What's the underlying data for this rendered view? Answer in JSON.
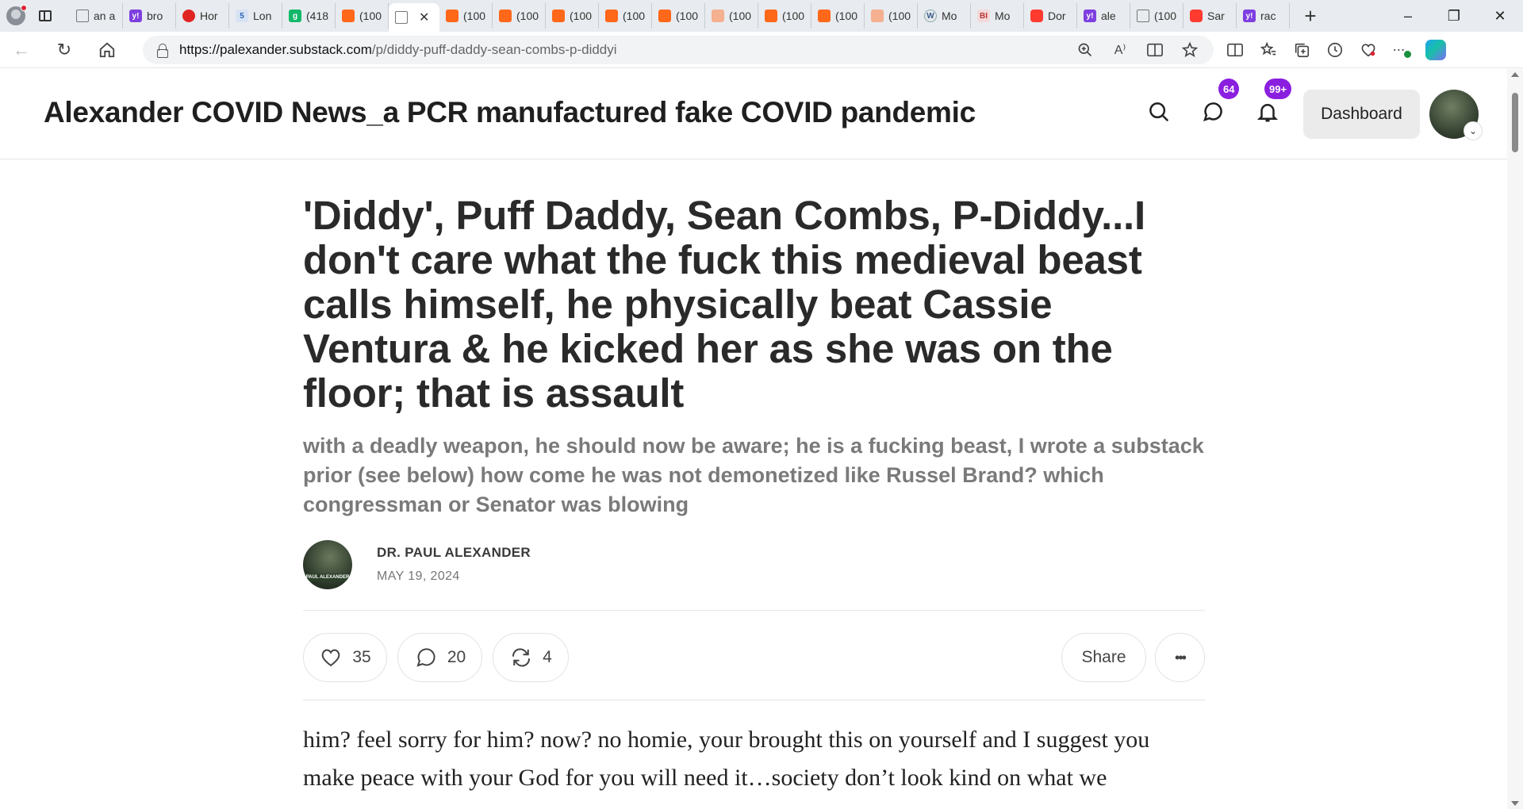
{
  "browser": {
    "tabs": [
      {
        "label": "an a",
        "icon": "document-icon"
      },
      {
        "label": "bro",
        "icon": "yahoo-icon"
      },
      {
        "label": "Hor",
        "icon": "red-pin-icon"
      },
      {
        "label": "Lon",
        "icon": "five-icon"
      },
      {
        "label": "(418",
        "icon": "g-icon"
      },
      {
        "label": "(100",
        "icon": "substack-icon"
      },
      {
        "label": "",
        "icon": "document-icon",
        "active": true
      },
      {
        "label": "(100",
        "icon": "substack-icon"
      },
      {
        "label": "(100",
        "icon": "substack-icon"
      },
      {
        "label": "(100",
        "icon": "substack-icon"
      },
      {
        "label": "(100",
        "icon": "substack-icon"
      },
      {
        "label": "(100",
        "icon": "substack-icon"
      },
      {
        "label": "(100",
        "icon": "substack-light-icon"
      },
      {
        "label": "(100",
        "icon": "substack-icon"
      },
      {
        "label": "(100",
        "icon": "substack-icon"
      },
      {
        "label": "(100",
        "icon": "substack-light-icon"
      },
      {
        "label": "Mo",
        "icon": "wordpress-icon"
      },
      {
        "label": "Mo",
        "icon": "bi-icon"
      },
      {
        "label": "Dor",
        "icon": "youtube-icon"
      },
      {
        "label": "ale",
        "icon": "yahoo-icon"
      },
      {
        "label": "(100",
        "icon": "document-icon"
      },
      {
        "label": "Sar",
        "icon": "youtube-icon"
      },
      {
        "label": "rac",
        "icon": "yahoo-icon"
      }
    ],
    "url_host": "https://palexander.substack.com",
    "url_path": "/p/diddy-puff-daddy-sean-combs-p-diddyi"
  },
  "site": {
    "title": "Alexander COVID News_a PCR manufactured fake COVID pandemic",
    "chat_badge": "64",
    "notif_badge": "99+",
    "dashboard_label": "Dashboard"
  },
  "post": {
    "title": "'Diddy', Puff Daddy, Sean Combs, P-Diddy...I don't care what the fuck this medieval beast calls himself, he physically beat Cassie Ventura & he kicked her as she was on the floor; that is assault",
    "subtitle": "with a deadly weapon, he should now be aware; he is a fucking beast, I wrote a substack prior (see below) how come he was not demonetized like Russel Brand? which congressman or Senator was blowing",
    "author": "DR. PAUL ALEXANDER",
    "date": "MAY 19, 2024",
    "avatar_caption": "PAUL ALEXANDER",
    "likes": "35",
    "comments": "20",
    "restacks": "4",
    "share_label": "Share",
    "more_label": "•••",
    "body": "him? feel sorry for him? now? no homie, your brought this on yourself and I suggest you make peace with your God for you will need it…society don’t look kind on what we"
  },
  "colors": {
    "badge": "#8b1fe0",
    "substack": "#ff6719",
    "dashboard_bg": "#ebebeb"
  }
}
